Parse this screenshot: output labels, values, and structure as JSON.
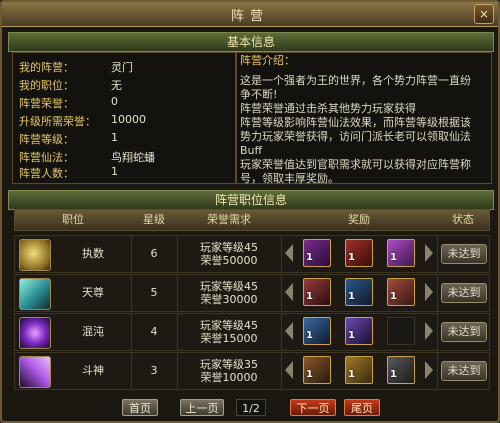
{
  "window": {
    "title": "阵营",
    "close": "×"
  },
  "basic": {
    "header": "基本信息",
    "rows": [
      {
        "label": "我的阵营：",
        "value": "灵门"
      },
      {
        "label": "我的职位：",
        "value": "无"
      },
      {
        "label": "阵营荣誉：",
        "value": "0"
      },
      {
        "label": "升级所需荣誉：",
        "value": "10000"
      },
      {
        "label": "阵营等级：",
        "value": "1"
      },
      {
        "label": "阵营仙法：",
        "value": "鸟翔蛇蟠"
      },
      {
        "label": "阵营人数：",
        "value": "1"
      }
    ],
    "intro_title": "阵营介绍：",
    "intro_lines": [
      "这是一个强者为王的世界，各个势力阵营一直纷",
      "争不断!",
      "阵营荣誉通过击杀其他势力玩家获得",
      "阵营等级影响阵营仙法效果，而阵营等级根据该",
      "势力玩家荣誉获得，访问门派长老可以领取仙法",
      "Buff",
      "玩家荣誉值达到官职需求就可以获得对应阵营称",
      "号，领取丰厚奖励。"
    ]
  },
  "ranks": {
    "header": "阵营职位信息",
    "columns": [
      "职位",
      "星级",
      "荣誉需求",
      "奖励",
      "状态"
    ],
    "rows": [
      {
        "name": "执数",
        "star": "6",
        "req_level": "玩家等级45",
        "req_honor": "荣誉50000",
        "counts": [
          "1",
          "1",
          "1"
        ],
        "status": "未达到",
        "icon_color": "#c9a63a"
      },
      {
        "name": "天尊",
        "star": "5",
        "req_level": "玩家等级45",
        "req_honor": "荣誉30000",
        "counts": [
          "1",
          "1",
          "1"
        ],
        "status": "未达到",
        "icon_color": "#3ab8a8"
      },
      {
        "name": "混沌",
        "star": "4",
        "req_level": "玩家等级45",
        "req_honor": "荣誉15000",
        "counts": [
          "1",
          "1"
        ],
        "status": "未达到",
        "icon_color": "#8a3ad0"
      },
      {
        "name": "斗神",
        "star": "3",
        "req_level": "玩家等级35",
        "req_honor": "荣誉10000",
        "counts": [
          "1",
          "1",
          "1"
        ],
        "status": "未达到",
        "icon_color": "#9a4ad8"
      }
    ]
  },
  "pager": {
    "first": "首页",
    "prev": "上一页",
    "page": "1/2",
    "next": "下一页",
    "last": "尾页"
  },
  "colors": {
    "gold_label": "#e7c86a",
    "slot_border": "#caa24a",
    "red_button": "#c43a1a"
  }
}
